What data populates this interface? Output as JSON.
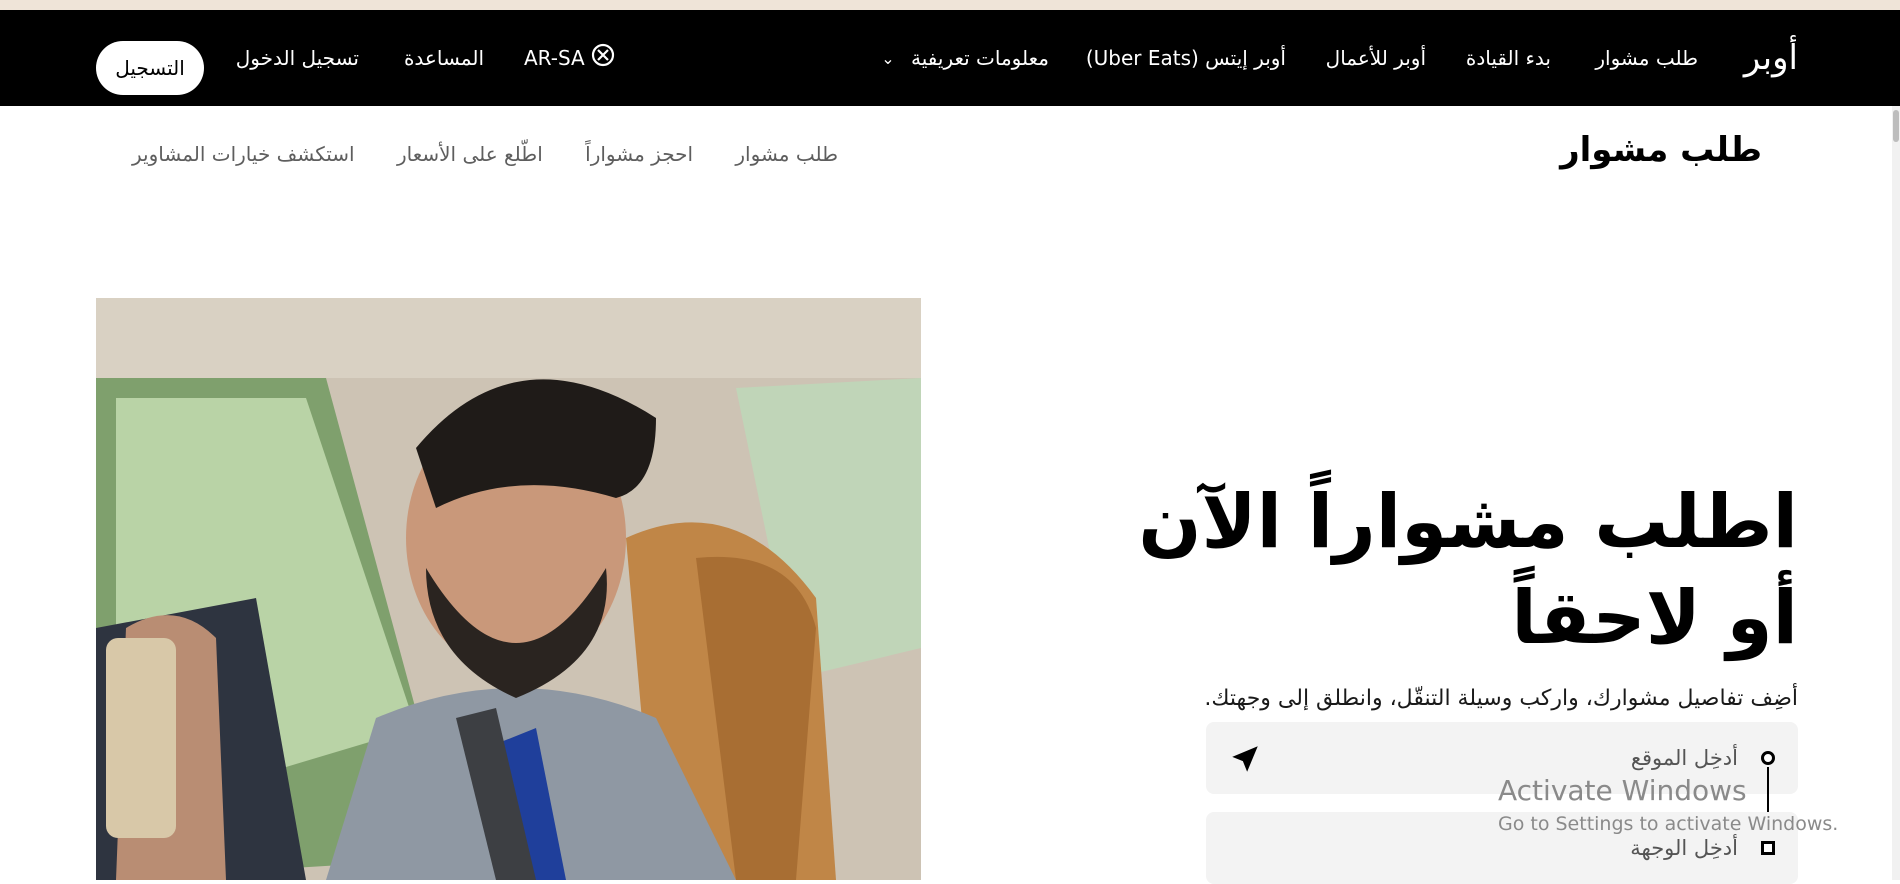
{
  "top_nav": {
    "logo": "أوبر",
    "links": [
      "طلب مشوار",
      "بدء القيادة",
      "أوبر للأعمال",
      "أوبر إيتس (Uber Eats)",
      "معلومات تعريفية"
    ],
    "language": "AR-SA",
    "help": "المساعدة",
    "login": "تسجيل الدخول",
    "signup": "التسجيل"
  },
  "sub_nav": {
    "title": "طلب مشوار",
    "links": [
      "طلب مشوار",
      "احجز مشواراً",
      "اطّلع على الأسعار",
      "استكشف خيارات المشاوير"
    ]
  },
  "hero": {
    "title": "اطلب مشواراً الآن أو لاحقاً",
    "subtitle": "أضِف تفاصيل مشوارك، واركب وسيلة التنقّل، وانطلق إلى وجهتك.",
    "pickup_placeholder": "أدخِل الموقع",
    "destination_placeholder": "أدخِل الوجهة"
  },
  "watermark": {
    "line1": "Activate Windows",
    "line2": "Go to Settings to activate Windows."
  },
  "colors": {
    "nav_bg": "#000000",
    "field_bg": "#f3f3f3",
    "strip": "#efe4d8"
  }
}
